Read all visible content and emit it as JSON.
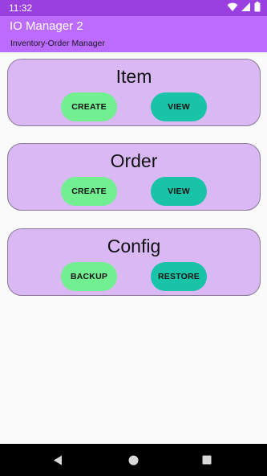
{
  "status_bar": {
    "time": "11:32",
    "icons": [
      "wifi-icon",
      "signal-icon",
      "battery-icon"
    ]
  },
  "app_bar": {
    "title": "IO Manager 2",
    "subtitle": "Inventory-Order Manager"
  },
  "cards": [
    {
      "title": "Item",
      "left_button": "CREATE",
      "right_button": "VIEW"
    },
    {
      "title": "Order",
      "left_button": "CREATE",
      "right_button": "VIEW"
    },
    {
      "title": "Config",
      "left_button": "BACKUP",
      "right_button": "RESTORE"
    }
  ],
  "nav_bar": {
    "icons": [
      "back-icon",
      "home-icon",
      "recents-icon"
    ]
  },
  "colors": {
    "status_bar": "#9a3fe0",
    "app_bar": "#bb6bff",
    "card_background": "#dab8f4",
    "primary_button": "#71ef91",
    "secondary_button": "#19c3a8"
  }
}
